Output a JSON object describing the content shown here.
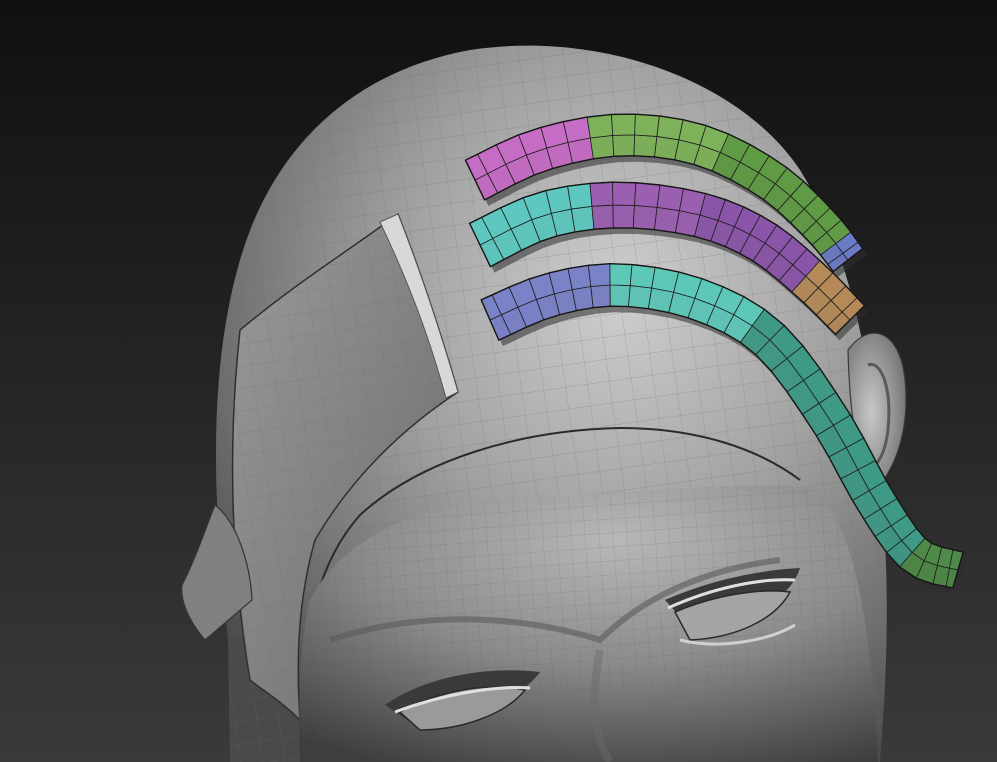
{
  "viewport": {
    "background_top": "#101010",
    "background_bottom": "#3a3a3a"
  },
  "model": {
    "surface_color": "#8e8e8e",
    "surface_light": "#c4c4c4",
    "surface_dark": "#4a4a4a",
    "wireframe_color": "#5c5c5c"
  },
  "hair_strips": [
    {
      "name": "strip-top",
      "polygroup_colors": [
        "#c56cc4",
        "#7eb25a",
        "#5f9a45",
        "#6a7ac4"
      ]
    },
    {
      "name": "strip-middle",
      "polygroup_colors": [
        "#5ec8c0",
        "#9a5fb0",
        "#8a55a8",
        "#b58a58"
      ]
    },
    {
      "name": "strip-bottom",
      "polygroup_colors": [
        "#7a82c8",
        "#5ec8b8",
        "#3f9a85",
        "#4f8a48"
      ]
    }
  ]
}
